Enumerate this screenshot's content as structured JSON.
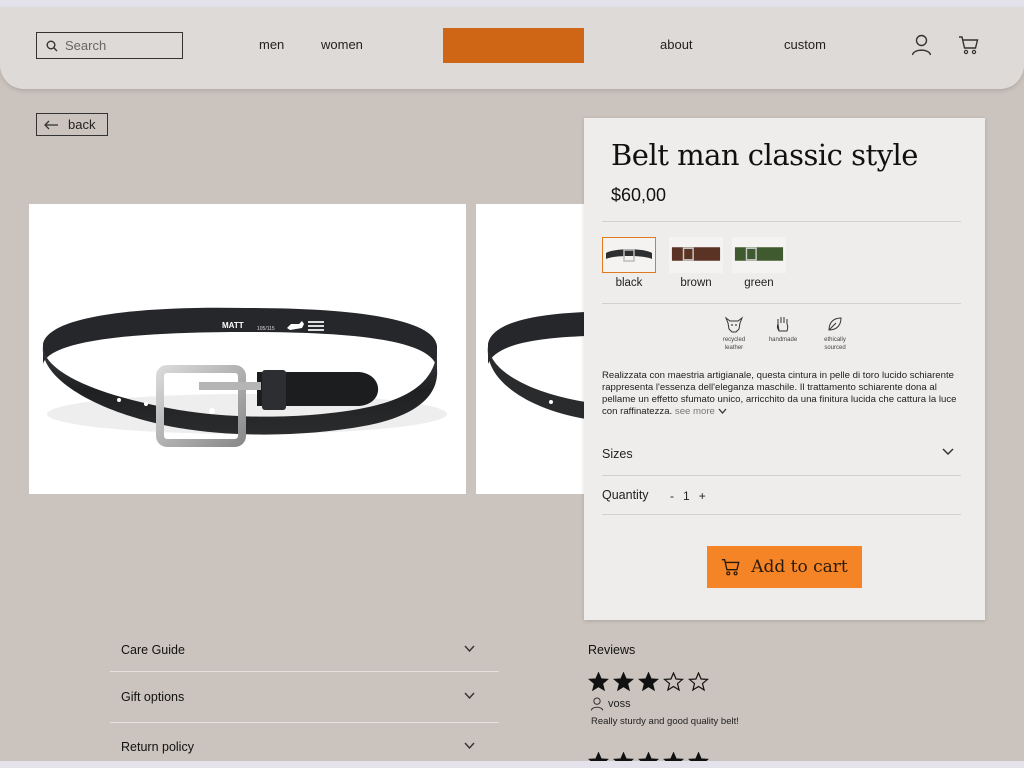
{
  "header": {
    "search_placeholder": "Search",
    "nav": [
      "men",
      "women",
      "about",
      "custom"
    ],
    "brand_color": "#cf6616",
    "icons": [
      "user-icon",
      "cart-icon"
    ]
  },
  "back_label": "back",
  "product": {
    "title": "Belt man classic style",
    "price": "$60,00",
    "colors": [
      {
        "label": "black",
        "hex": "#2e2f31",
        "selected": true
      },
      {
        "label": "brown",
        "hex": "#5a3325",
        "selected": false
      },
      {
        "label": "green",
        "hex": "#3f5a2e",
        "selected": false
      }
    ],
    "features": [
      {
        "label_line1": "recycled",
        "label_line2": "leather",
        "icon": "cow-icon"
      },
      {
        "label_line1": "handmade",
        "label_line2": "",
        "icon": "hand-icon"
      },
      {
        "label_line1": "ethically",
        "label_line2": "sourced",
        "icon": "leaf-icon"
      }
    ],
    "description": "Realizzata con maestria artigianale, questa cintura in pelle di toro lucido schiarente rappresenta l'essenza dell'eleganza maschile. Il trattamento schiarente dona al pellame un effetto sfumato unico, arricchito da una finitura lucida che cattura la luce con raffinatezza.",
    "see_more": "see more",
    "sizes_label": "Sizes",
    "quantity_label": "Quantity",
    "quantity_minus": "-",
    "quantity_value": "1",
    "quantity_plus": "+",
    "add_to_cart": "Add to cart",
    "accent_color": "#f58427"
  },
  "belt_branding": {
    "brand": "MATT",
    "size": "105/115"
  },
  "accordion": [
    "Care Guide",
    "Gift options",
    "Return policy"
  ],
  "reviews": {
    "title": "Reviews",
    "items": [
      {
        "stars": 3,
        "max": 5,
        "user": "voss",
        "text": "Really sturdy and good quality belt!"
      },
      {
        "stars": 5,
        "max": 5,
        "user": "",
        "text": ""
      }
    ]
  }
}
